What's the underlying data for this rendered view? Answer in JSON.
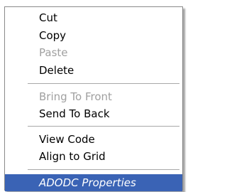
{
  "background": {
    "fragment": ""
  },
  "menu": {
    "items": [
      {
        "label": "Cut",
        "disabled": false
      },
      {
        "label": "Copy",
        "disabled": false
      },
      {
        "label": "Paste",
        "disabled": true
      },
      {
        "label": "Delete",
        "disabled": false
      },
      {
        "label": "Bring To Front",
        "disabled": true
      },
      {
        "label": "Send To Back",
        "disabled": false
      },
      {
        "label": "View Code",
        "disabled": false
      },
      {
        "label": "Align to Grid",
        "disabled": false
      },
      {
        "label": "ADODC Properties",
        "disabled": false,
        "highlighted": true
      }
    ]
  },
  "colors": {
    "highlight": "#3a63b5",
    "disabled_text": "#a0a0a0"
  }
}
